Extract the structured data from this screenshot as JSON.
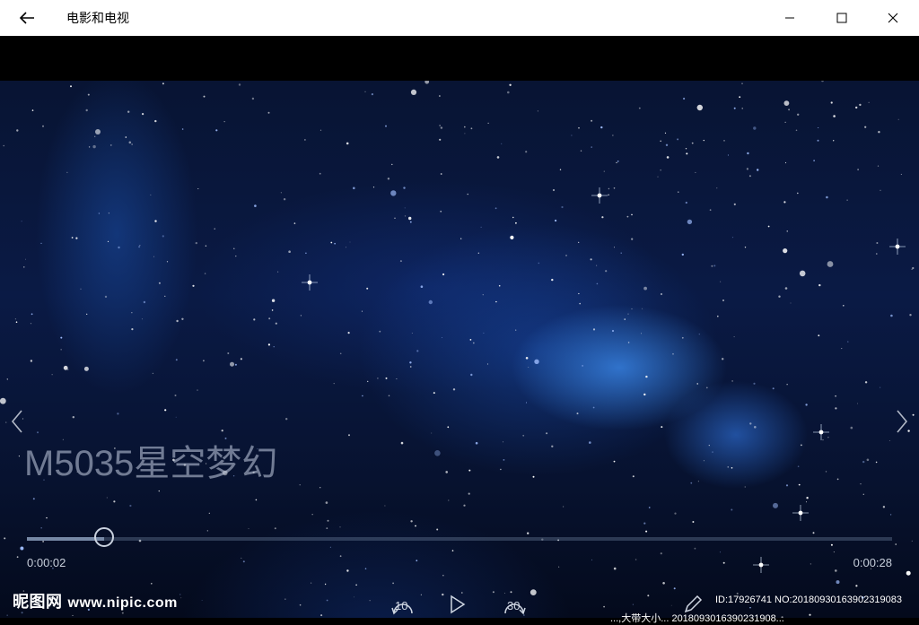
{
  "titlebar": {
    "title": "电影和电视",
    "back_icon": "arrow-left-icon",
    "minimize_icon": "minimize-icon",
    "maximize_icon": "maximize-icon",
    "close_icon": "close-icon"
  },
  "player": {
    "video_title": "M5035星空梦幻",
    "current_time": "0:00:02",
    "duration": "0:00:28",
    "progress_fraction": 0.089,
    "controls": {
      "skip_back_label": "10",
      "skip_forward_label": "30"
    }
  },
  "watermark": {
    "site_name": "昵图网",
    "site_url": "www.nipic.com",
    "image_id": "ID:17926741 NO:20180930163902319083",
    "bottom_strip": "...,大带大小... 2018093016390231908..."
  },
  "colors": {
    "titlebar_bg": "#ffffff",
    "video_bg": "#0a1a45",
    "text_light": "#c8cfdb"
  }
}
